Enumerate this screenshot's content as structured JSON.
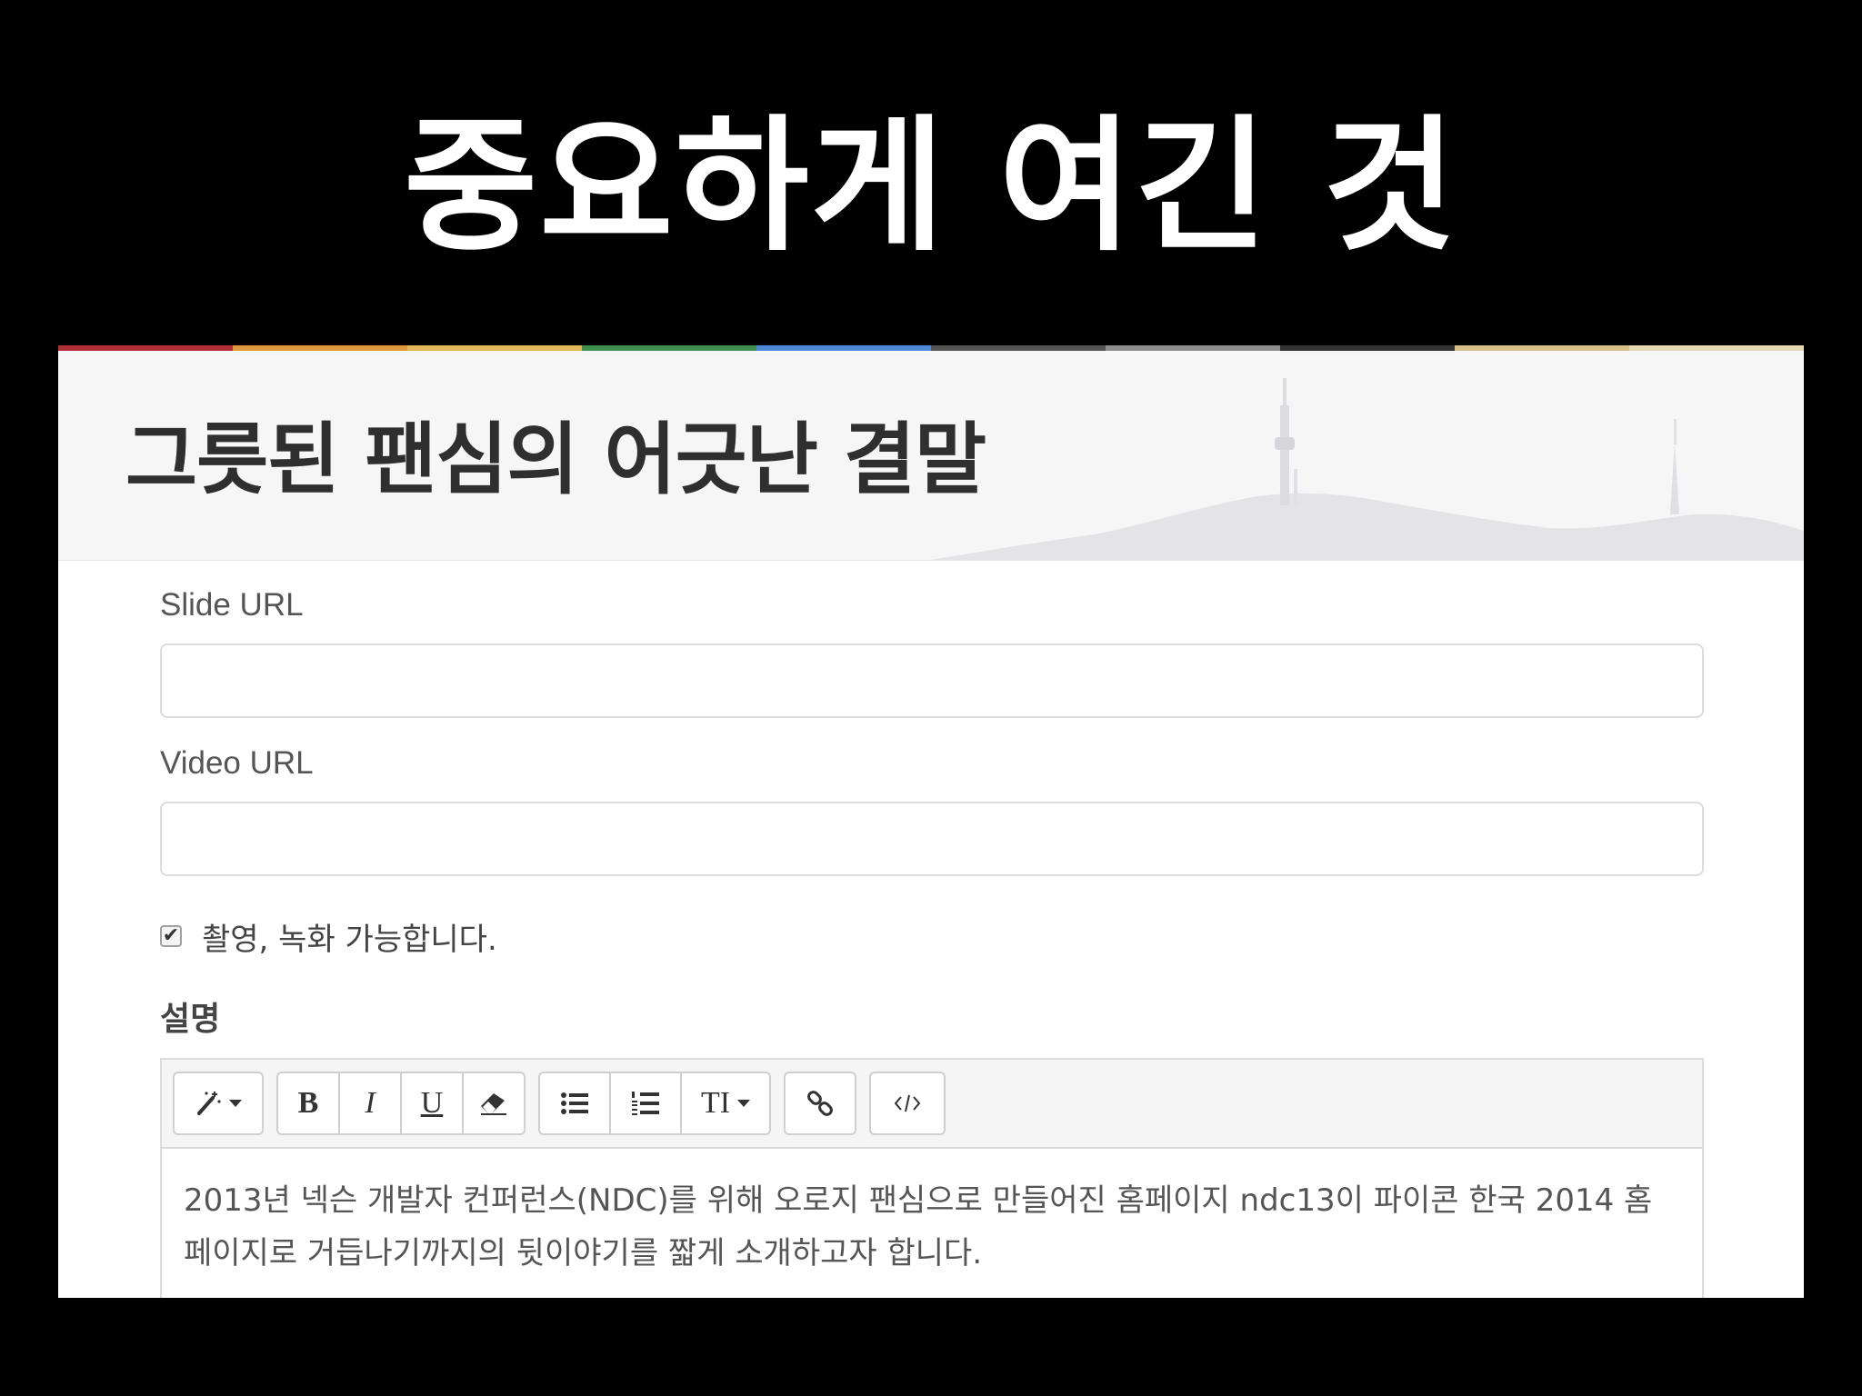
{
  "slide": {
    "title": "중요하게 여긴 것"
  },
  "site": {
    "header_title": "그릇된 팬심의 어긋난 결말",
    "accent_colors": [
      "#b22f3a",
      "#e0993a",
      "#e3b85b",
      "#3f8f50",
      "#4f88d8",
      "#555555",
      "#8c8c8c",
      "#333333",
      "#d8c08a",
      "#e6d7b0"
    ]
  },
  "form": {
    "slide_url": {
      "label": "Slide URL",
      "value": ""
    },
    "video_url": {
      "label": "Video URL",
      "value": ""
    },
    "recording": {
      "checked": true,
      "check_glyph": "✔",
      "label": "촬영, 녹화 가능합니다."
    },
    "description": {
      "label": "설명",
      "toolbar": {
        "style_icon": "magic-wand-icon",
        "bold": "B",
        "italic": "I",
        "underline": "U",
        "eraser_icon": "eraser-icon",
        "unordered_list_icon": "unordered-list-icon",
        "ordered_list_icon": "ordered-list-icon",
        "font_size": "TI",
        "link_icon": "link-icon",
        "code_icon": "code-view-icon"
      },
      "text": "2013년 넥슨 개발자 컨퍼런스(NDC)를 위해 오로지 팬심으로 만들어진 홈페이지 ndc13이 파이콘 한국 2014 홈페이지로 거듭나기까지의 뒷이야기를 짧게 소개하고자 합니다."
    }
  }
}
